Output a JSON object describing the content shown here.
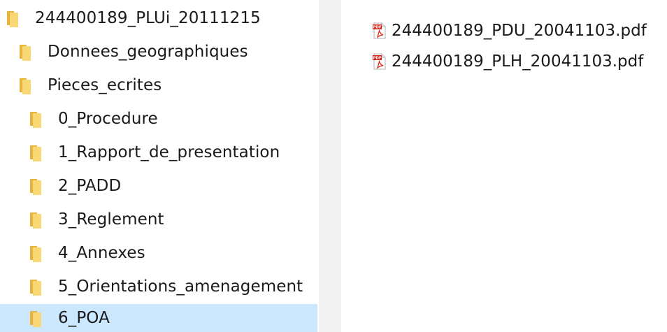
{
  "tree": {
    "items": [
      {
        "label": "244400189_PLUi_20111215",
        "level": 0,
        "selected": false
      },
      {
        "label": "Donnees_geographiques",
        "level": 1,
        "selected": false
      },
      {
        "label": "Pieces_ecrites",
        "level": 1,
        "selected": false
      },
      {
        "label": "0_Procedure",
        "level": 2,
        "selected": false
      },
      {
        "label": "1_Rapport_de_presentation",
        "level": 2,
        "selected": false
      },
      {
        "label": "2_PADD",
        "level": 2,
        "selected": false
      },
      {
        "label": "3_Reglement",
        "level": 2,
        "selected": false
      },
      {
        "label": "4_Annexes",
        "level": 2,
        "selected": false
      },
      {
        "label": "5_Orientations_amenagement",
        "level": 2,
        "selected": false
      },
      {
        "label": "6_POA",
        "level": 2,
        "selected": true
      }
    ],
    "folder_icon": "folder-icon",
    "selection_color": "#cce8ff"
  },
  "files": {
    "items": [
      {
        "name": "244400189_PDU_20041103.pdf",
        "icon": "pdf-icon"
      },
      {
        "name": "244400189_PLH_20041103.pdf",
        "icon": "pdf-icon"
      }
    ]
  },
  "colors": {
    "folder_front": "#f8d775",
    "folder_back": "#e8b33a",
    "pdf_red": "#d9261c",
    "splitter": "#f3f3f3"
  }
}
